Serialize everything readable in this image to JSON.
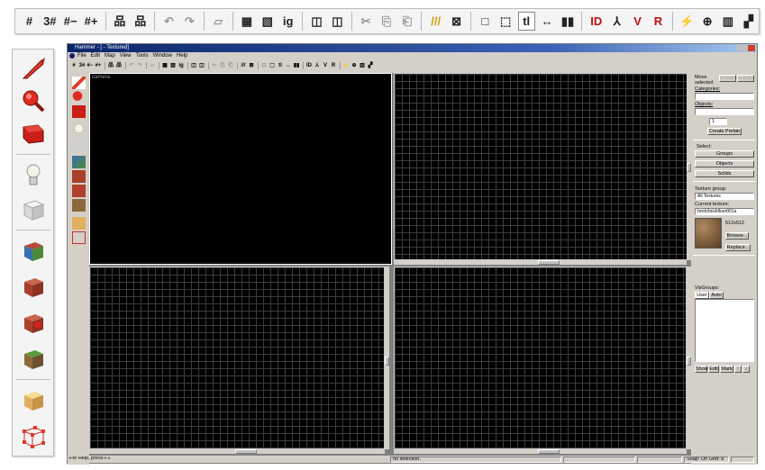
{
  "app": {
    "title": "Hammer - [ - Textured]",
    "menu": [
      "File",
      "Edit",
      "Map",
      "View",
      "Tools",
      "Window",
      "Help"
    ]
  },
  "big_toolbar": {
    "items": [
      {
        "icon": "grid-toggle-icon",
        "glyph": "#"
      },
      {
        "icon": "3d-grid-icon",
        "glyph": "3#"
      },
      {
        "icon": "smaller-grid-icon",
        "glyph": "#−"
      },
      {
        "icon": "larger-grid-icon",
        "glyph": "#+"
      },
      {
        "sep": true
      },
      {
        "icon": "carve-icon",
        "glyph": "品"
      },
      {
        "icon": "group-icon",
        "glyph": "品"
      },
      {
        "sep": true
      },
      {
        "icon": "undo-icon",
        "glyph": "↶",
        "disabled": true
      },
      {
        "icon": "redo-icon",
        "glyph": "↷",
        "disabled": true
      },
      {
        "sep": true
      },
      {
        "icon": "flip-icon",
        "glyph": "▱",
        "disabled": true
      },
      {
        "sep": true
      },
      {
        "icon": "toggle-group-ignore-icon",
        "glyph": "▦"
      },
      {
        "icon": "hide-items-icon",
        "glyph": "▧"
      },
      {
        "icon": "ignore-groups-icon",
        "glyph": "ig"
      },
      {
        "sep": true
      },
      {
        "icon": "texture-lock-icon",
        "glyph": "◫"
      },
      {
        "icon": "texture-scale-lock-icon",
        "glyph": "◫"
      },
      {
        "sep": true
      },
      {
        "icon": "cut-icon",
        "glyph": "✂",
        "disabled": true
      },
      {
        "icon": "copy-icon",
        "glyph": "⎘",
        "disabled": true
      },
      {
        "icon": "paste-icon",
        "glyph": "⎗",
        "disabled": true
      },
      {
        "sep": true
      },
      {
        "icon": "toggle-cordon-icon",
        "glyph": "///"
      },
      {
        "icon": "edit-cordon-icon",
        "glyph": "⊠"
      },
      {
        "sep": true
      },
      {
        "icon": "handles-icon",
        "glyph": "□"
      },
      {
        "icon": "selection-handles-icon",
        "glyph": "⬚"
      },
      {
        "icon": "texture-lock-t-icon",
        "glyph": "tl",
        "active": true
      },
      {
        "icon": "align-icon",
        "glyph": "↔"
      },
      {
        "icon": "skew-icon",
        "glyph": "▮▮"
      },
      {
        "sep": true
      },
      {
        "icon": "show-ids-icon",
        "glyph": "ID"
      },
      {
        "icon": "run-map-icon",
        "glyph": "⅄"
      },
      {
        "icon": "vis-icon",
        "glyph": "V"
      },
      {
        "icon": "map-info-icon",
        "glyph": "R"
      },
      {
        "sep": true
      },
      {
        "icon": "entity-report-icon",
        "glyph": "⚡"
      },
      {
        "icon": "check-problems-icon",
        "glyph": "⊕"
      },
      {
        "icon": "model-icon",
        "glyph": "▥"
      },
      {
        "icon": "wireframe-icon",
        "glyph": "▞"
      }
    ]
  },
  "left_toolbar": {
    "items": [
      "selection-tool-icon",
      "magnify-tool-icon",
      "camera-tool-icon",
      "entity-tool-icon",
      "block-tool-icon",
      "toggle-texture-application-icon",
      "apply-current-texture-icon",
      "apply-decals-icon",
      "apply-overlays-icon",
      "clipping-tool-icon",
      "vertex-manipulation-tool-icon"
    ]
  },
  "viewports": {
    "camera_label": "camera"
  },
  "right_panel": {
    "move_selected": "Move selected",
    "ignore_btn": "to World",
    "to_entity_btn": "to Entity",
    "categories_label": "Categories:",
    "objects_label": "Objects:",
    "spinner_value": "1",
    "create_prefab": "Create Prefab",
    "select_label": "Select:",
    "groups_btn": "Groups",
    "objects_btn": "Objects",
    "solids_btn": "Solids",
    "texture_group_label": "Texture group:",
    "texture_group_value": "All Textures",
    "current_texture_label": "Current texture:",
    "current_texture_value": "brick/brickfloor001a",
    "texture_size": "512x512",
    "browse_btn": "Browse...",
    "replace_btn": "Replace...",
    "visgroups_label": "VisGroups:",
    "user_tab": "User",
    "auto_tab": "Auto",
    "show_btn": "Show",
    "edit_btn": "Edit",
    "mark_btn": "Mark"
  },
  "status": {
    "help": "For Help, press F1",
    "selection": "no selection.",
    "snap": "Snap: On Grid: 8"
  }
}
